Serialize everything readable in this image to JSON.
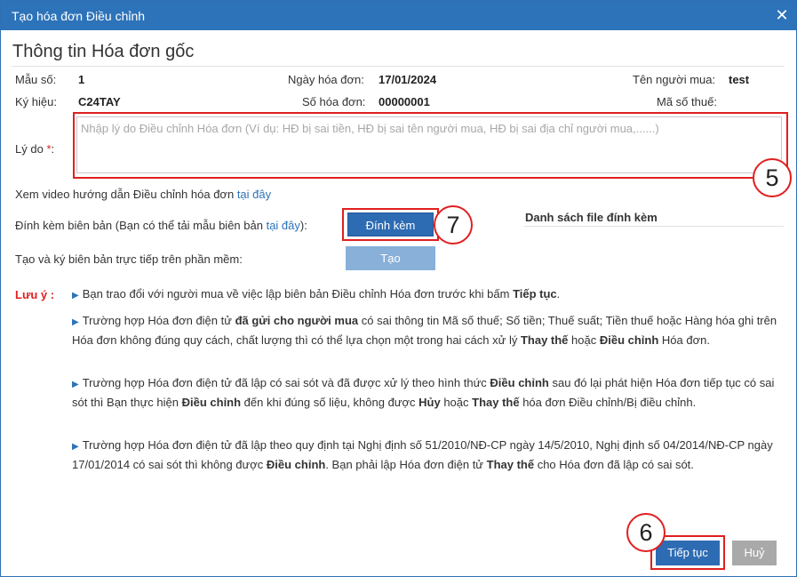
{
  "dialog": {
    "title": "Tạo hóa đơn Điều chỉnh"
  },
  "section": {
    "title": "Thông tin Hóa đơn gốc"
  },
  "info": {
    "form_label": "Mẫu số:",
    "form_value": "1",
    "date_label": "Ngày hóa đơn:",
    "date_value": "17/01/2024",
    "buyer_label": "Tên người mua:",
    "buyer_value": "test",
    "symbol_label": "Ký hiệu:",
    "symbol_value": "C24TAY",
    "number_label": "Số hóa đơn:",
    "number_value": "00000001",
    "tax_label": "Mã số thuế:"
  },
  "reason": {
    "label": "Lý do",
    "required_mark": "*",
    "colon": ":",
    "placeholder": "Nhập lý do Điều chỉnh Hóa đơn (Ví dụ: HĐ bị sai tiền, HĐ bị sai tên người mua, HĐ bị sai địa chỉ người mua,......)",
    "value": ""
  },
  "video": {
    "text": "Xem video hướng dẫn Điều chỉnh hóa đơn",
    "link": "tại đây"
  },
  "attach": {
    "text_before": "Đính kèm biên bản (Bạn có thể tải mẫu biên bản",
    "link": "tại đây",
    "text_after": "):",
    "button": "Đính kèm",
    "file_list_title": "Danh sách file đính kèm"
  },
  "create": {
    "text": "Tạo và ký biên bản trực tiếp trên phần mềm:",
    "button": "Tạo"
  },
  "notes": {
    "label": "Lưu ý",
    "colon": ":",
    "n1": {
      "a": "Bạn trao đổi với người mua về việc lập biên bản Điều chỉnh Hóa đơn trước khi bấm ",
      "b": "Tiếp tục",
      "c": "."
    },
    "n2": {
      "a": "Trường hợp Hóa đơn điện tử ",
      "b": "đã gửi cho người mua",
      "c": " có sai thông tin Mã số thuế; Số tiền; Thuế suất; Tiền thuế hoặc Hàng hóa ghi trên Hóa đơn không đúng quy cách, chất lượng thì có thể lựa chọn một trong hai cách xử lý ",
      "d": "Thay thế",
      "e": " hoặc ",
      "f": "Điều chỉnh",
      "g": " Hóa đơn."
    },
    "n3": {
      "a": "Trường hợp Hóa đơn điện tử đã lập có sai sót và đã được xử lý theo hình thức ",
      "b": "Điều chỉnh",
      "c": " sau đó lại phát hiện Hóa đơn tiếp tục có sai sót thì Bạn thực hiện ",
      "d": "Điều chỉnh",
      "e": " đến khi đúng số liệu, không được ",
      "f": "Hủy",
      "g": " hoặc ",
      "h": "Thay thế",
      "i": " hóa đơn Điều chỉnh/Bị điều chỉnh."
    },
    "n4": {
      "a": "Trường hợp Hóa đơn điện tử đã lập theo quy định tại Nghị định số 51/2010/NĐ-CP ngày 14/5/2010, Nghị định số 04/2014/NĐ-CP ngày 17/01/2014 có sai sót thì không được ",
      "b": "Điều chỉnh",
      "c": ". Bạn phải lập Hóa đơn điện tử ",
      "d": "Thay thế",
      "e": " cho Hóa đơn đã lập có sai sót."
    }
  },
  "footer": {
    "continue": "Tiếp tục",
    "cancel": "Huỷ"
  },
  "annotations": {
    "a5": "5",
    "a6": "6",
    "a7": "7"
  },
  "colors": {
    "primary": "#2d73b9",
    "annotation": "#e02020",
    "disabled_button": "#88b0d8",
    "cancel_button": "#a9a9a9"
  }
}
